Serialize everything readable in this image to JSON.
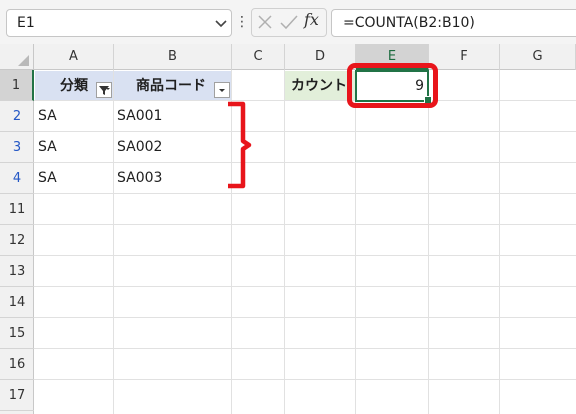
{
  "name_box": {
    "value": "E1"
  },
  "formula_bar": {
    "more_glyph": "⋮",
    "fx_label": "fx",
    "formula": "=COUNTA(B2:B10)"
  },
  "columns": [
    "A",
    "B",
    "C",
    "D",
    "E",
    "F",
    "G"
  ],
  "rows": [
    "1",
    "2",
    "3",
    "4",
    "11",
    "12",
    "13",
    "14",
    "15",
    "16",
    "17"
  ],
  "header_row": {
    "a1": "分類",
    "b1": "商品コード",
    "d1": "カウント",
    "e1": "9"
  },
  "data_rows": [
    {
      "category": "SA",
      "code": "SA001"
    },
    {
      "category": "SA",
      "code": "SA002"
    },
    {
      "category": "SA",
      "code": "SA003"
    }
  ],
  "colors": {
    "accent": "#217346",
    "header_fill": "#d9e1f2",
    "count_fill": "#e2efda",
    "highlight": "#e8151b",
    "row_number_blue": "#2457c5"
  }
}
